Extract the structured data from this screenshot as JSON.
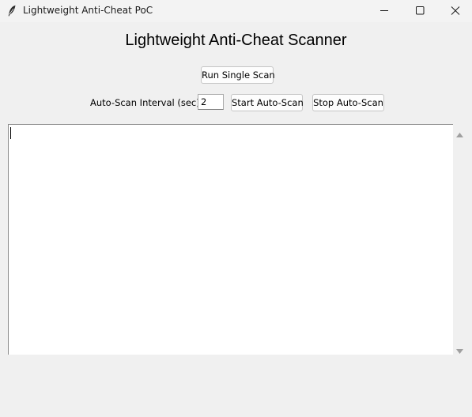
{
  "window": {
    "title": "Lightweight Anti-Cheat PoC",
    "icon": "feather-icon",
    "controls": [
      "minimize-icon",
      "maximize-icon",
      "close-icon"
    ]
  },
  "main": {
    "heading": "Lightweight Anti-Cheat Scanner",
    "single_scan_label": "Run Single Scan",
    "interval_label": "Auto-Scan Interval (sec):",
    "interval_value": "2",
    "start_auto_label": "Start Auto-Scan",
    "stop_auto_label": "Stop Auto-Scan",
    "log_text": ""
  },
  "colors": {
    "background": "#f0f0f0",
    "button_bg": "#fdfdfd",
    "text_area_bg": "#ffffff"
  }
}
